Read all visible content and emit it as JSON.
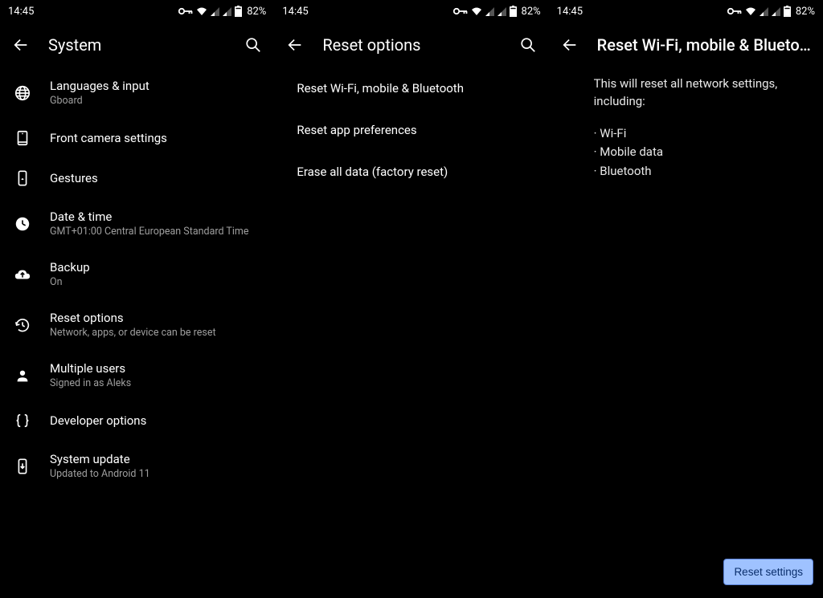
{
  "status": {
    "time": "14:45",
    "battery": "82%"
  },
  "pane1": {
    "title": "System",
    "items": [
      {
        "title": "Languages & input",
        "sub": "Gboard"
      },
      {
        "title": "Front camera settings",
        "sub": ""
      },
      {
        "title": "Gestures",
        "sub": ""
      },
      {
        "title": "Date & time",
        "sub": "GMT+01:00 Central European Standard Time"
      },
      {
        "title": "Backup",
        "sub": "On"
      },
      {
        "title": "Reset options",
        "sub": "Network, apps, or device can be reset"
      },
      {
        "title": "Multiple users",
        "sub": "Signed in as Aleks"
      },
      {
        "title": "Developer options",
        "sub": ""
      },
      {
        "title": "System update",
        "sub": "Updated to Android 11"
      }
    ]
  },
  "pane2": {
    "title": "Reset options",
    "items": [
      {
        "title": "Reset Wi-Fi, mobile & Bluetooth"
      },
      {
        "title": "Reset app preferences"
      },
      {
        "title": "Erase all data (factory reset)"
      }
    ]
  },
  "pane3": {
    "title": "Reset Wi-Fi, mobile & Blueto…",
    "intro": "This will reset all network settings, including:",
    "bullets": [
      "Wi-Fi",
      "Mobile data",
      "Bluetooth"
    ],
    "button": "Reset settings"
  }
}
